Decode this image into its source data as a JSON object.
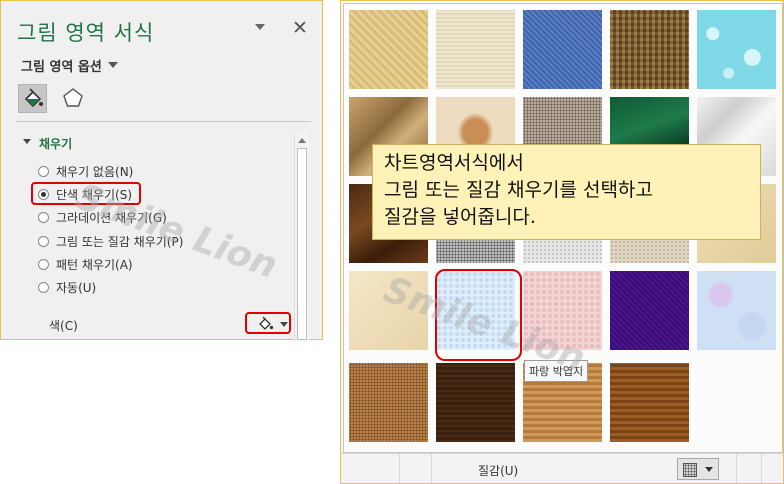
{
  "pane": {
    "title": "그림 영역 서식",
    "options_label": "그림 영역 옵션",
    "section_title": "채우기",
    "fill_options": [
      {
        "label": "채우기 없음(N)",
        "checked": false
      },
      {
        "label": "단색 채우기(S)",
        "checked": true
      },
      {
        "label": "그라데이션 채우기(G)",
        "checked": false
      },
      {
        "label": "그림 또는 질감 채우기(P)",
        "checked": false
      },
      {
        "label": "패턴 채우기(A)",
        "checked": false
      },
      {
        "label": "자동(U)",
        "checked": false
      }
    ],
    "color_label": "색(C)",
    "close_glyph": "✕"
  },
  "gallery": {
    "callout_lines": [
      "차트영역서식에서",
      "그림 또는 질감 채우기를 선택하고",
      "질감을 넣어줍니다."
    ],
    "tooltip": "파랑 박엽지",
    "texture_label": "질감(U)",
    "selected_texture": "파랑 박엽지",
    "textures": [
      "papyrus",
      "canvas",
      "denim",
      "woven-mat",
      "water-droplets",
      "paper-bag",
      "fish-fossil",
      "sand",
      "green-marble",
      "white-marble",
      "brown-marble",
      "granite",
      "newsprint",
      "recycled-paper",
      "parchment",
      "stationery",
      "blue-tissue-paper",
      "pink-tissue-paper",
      "purple-mesh",
      "bouquet",
      "cork",
      "walnut",
      "oak",
      "medium-wood"
    ]
  },
  "watermark": "Smile Lion",
  "colors": {
    "accent": "#217346",
    "highlight": "#e00000",
    "callout_bg": "#fff2b8"
  }
}
